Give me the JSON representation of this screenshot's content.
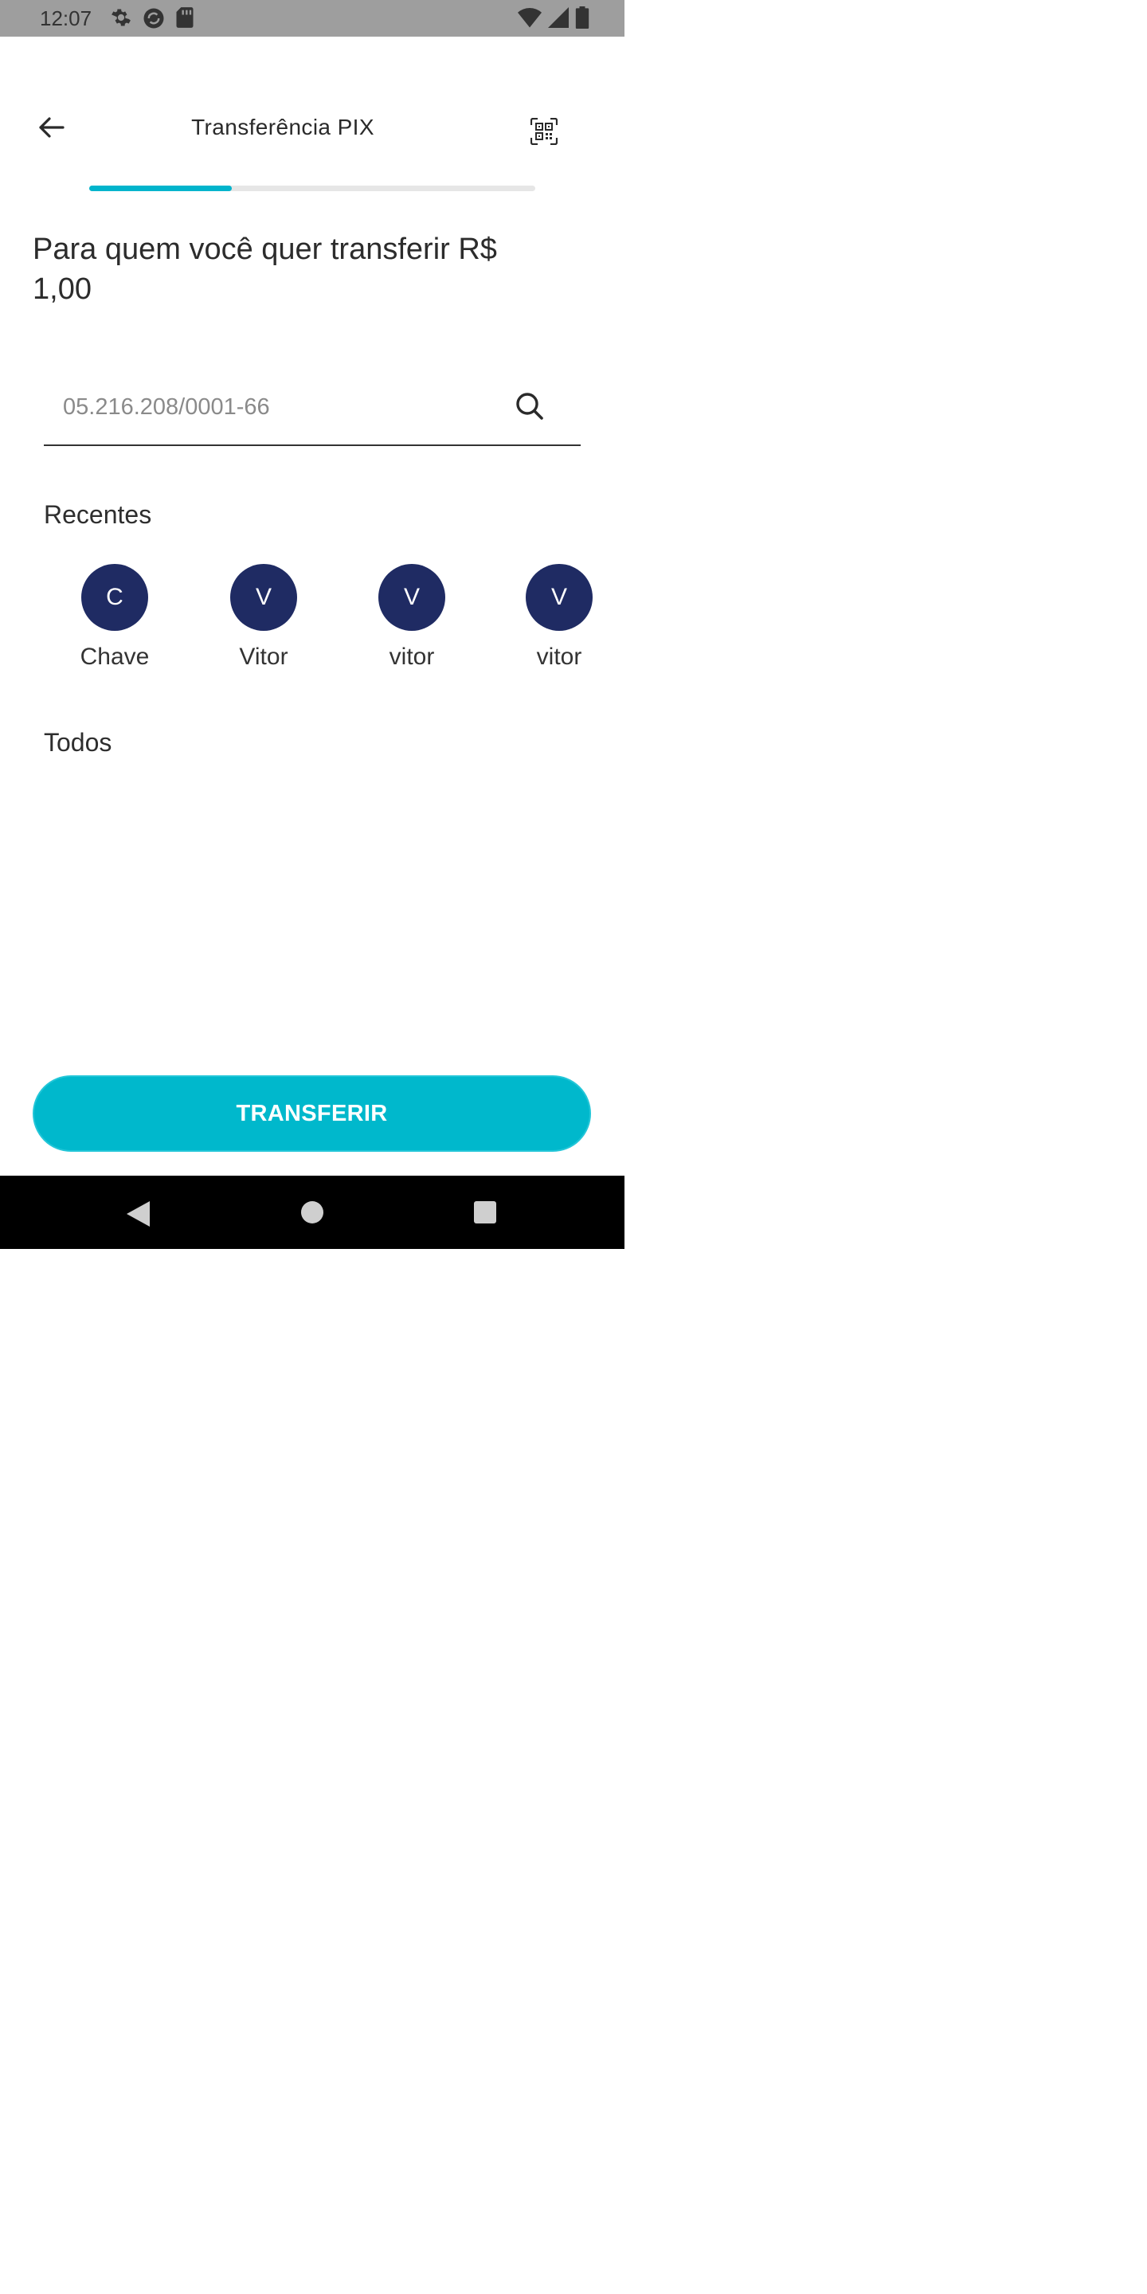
{
  "status_bar": {
    "time": "12:07"
  },
  "header": {
    "title": "Transferência PIX"
  },
  "progress": {
    "value": 0.32
  },
  "prompt": {
    "line1": "Para quem você quer transferir R$",
    "line2": "1,00"
  },
  "search": {
    "placeholder": "05.216.208/0001-66"
  },
  "recents": {
    "title": "Recentes",
    "contacts": [
      {
        "initial": "C",
        "name": "Chave"
      },
      {
        "initial": "V",
        "name": "Vitor"
      },
      {
        "initial": "V",
        "name": "vitor"
      },
      {
        "initial": "V",
        "name": "vitor"
      }
    ]
  },
  "all": {
    "title": "Todos"
  },
  "transfer_button": {
    "label": "TRANSFERIR"
  },
  "colors": {
    "accent": "#00b8cc",
    "avatar": "#1f2b63"
  },
  "icons": {
    "back": "arrow-left-icon",
    "qr": "qr-code-scan-icon",
    "search": "search-icon"
  }
}
